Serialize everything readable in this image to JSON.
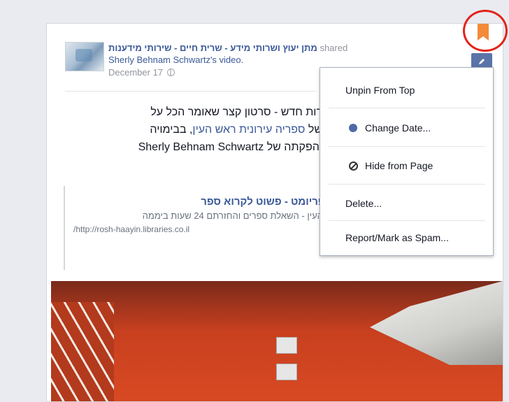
{
  "post": {
    "page_name": "מתן יעוץ ושרותי מידע - שרית חיים - שירותי מידענות",
    "shared_word": "shared",
    "shared_object": "Sherly Behnam Schwartz's video.",
    "date": "December 17",
    "text_line1": "רות חדש - סרטון קצר שאומר הכל על",
    "text_line2_pre": "של",
    "text_line2_link": "ספריה עירונית ראש העין",
    "text_line2_post": ", בבימויה",
    "text_line3_pre": "Sherly Behnam Schwartz",
    "text_line3_post": "והפקתה של",
    "link_preview": {
      "title": "ספריומט - פשוט לקרוא ספר",
      "description": "ש העין - השאלת ספרים והחזרתם 24 שעות ביממה",
      "url": "/http://rosh-haayin.libraries.co.il"
    }
  },
  "menu": {
    "items": [
      {
        "label": "Unpin From Top",
        "icon": ""
      },
      {
        "label": "Change Date...",
        "icon": "clock-icon"
      },
      {
        "label": "Hide from Page",
        "icon": "block-icon"
      },
      {
        "label": "Delete...",
        "icon": ""
      },
      {
        "label": "Report/Mark as Spam...",
        "icon": ""
      }
    ]
  },
  "icons": {
    "edit": "pencil-icon",
    "bookmark": "bookmark-icon",
    "privacy": "globe-icon"
  },
  "colors": {
    "link": "#3b5998",
    "bookmark": "#f28b3a",
    "highlight": "#e3221a",
    "edit_button": "#5b74a8"
  }
}
